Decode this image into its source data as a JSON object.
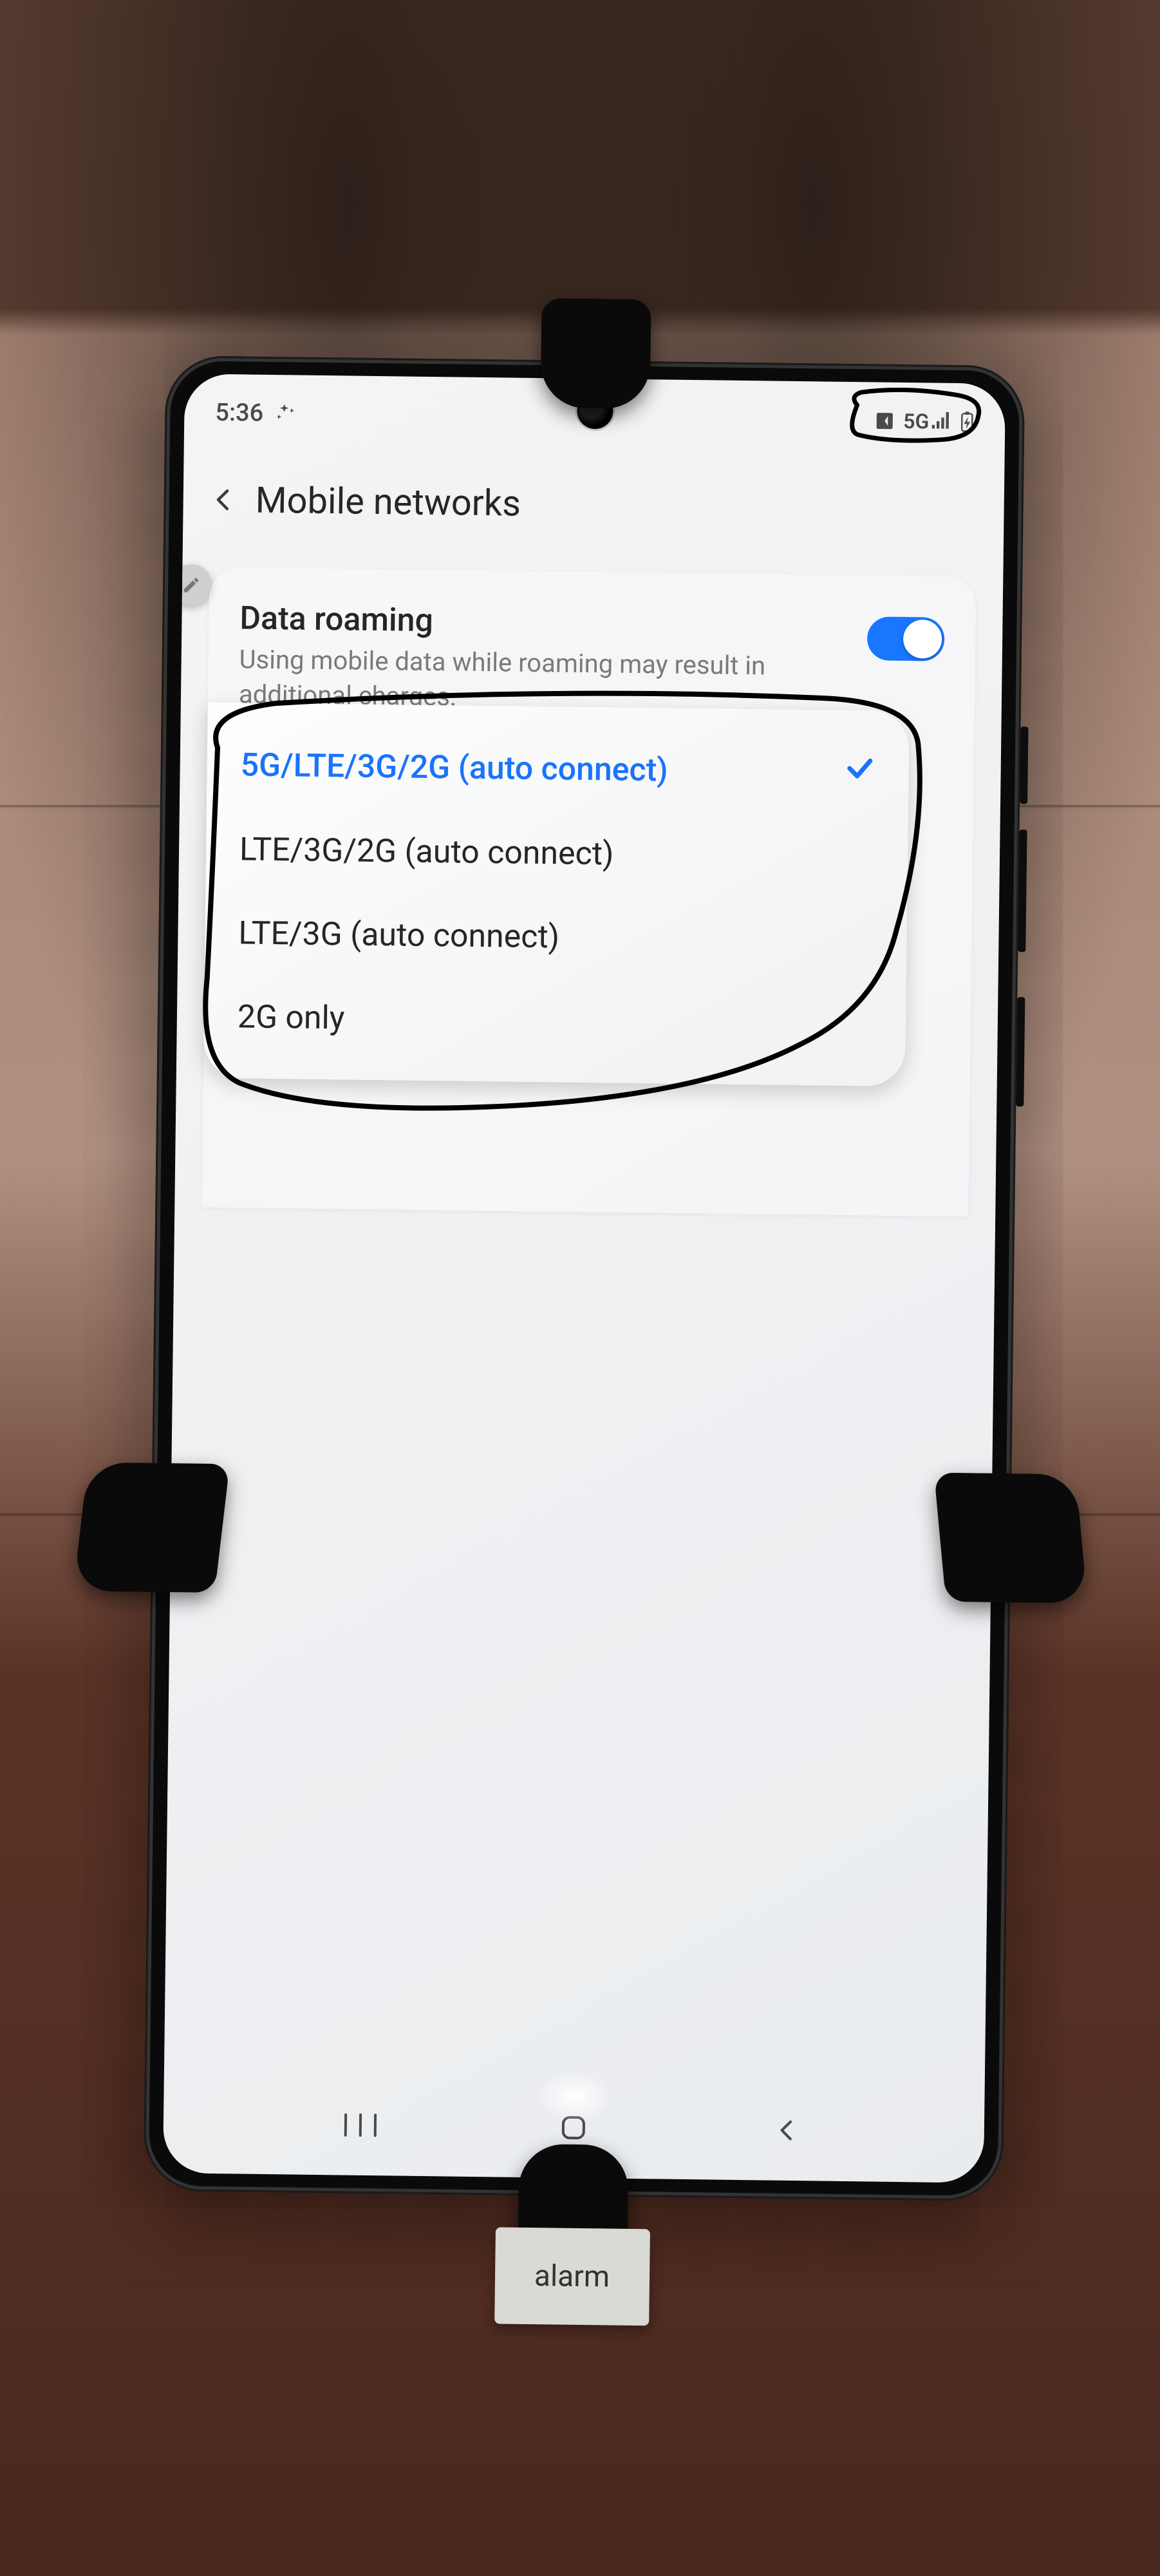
{
  "status": {
    "time": "5:36",
    "network_label": "5G"
  },
  "header": {
    "title": "Mobile networks"
  },
  "roaming": {
    "title": "Data roaming",
    "subtitle": "Using mobile data while roaming may result in additional charges.",
    "enabled": true
  },
  "network_mode": {
    "options": [
      {
        "label": "5G/LTE/3G/2G (auto connect)",
        "selected": true
      },
      {
        "label": "LTE/3G/2G (auto connect)",
        "selected": false
      },
      {
        "label": "LTE/3G (auto connect)",
        "selected": false
      },
      {
        "label": "2G only",
        "selected": false
      }
    ]
  },
  "tag": {
    "label": "alarm"
  },
  "colors": {
    "accent": "#1a73ff"
  }
}
